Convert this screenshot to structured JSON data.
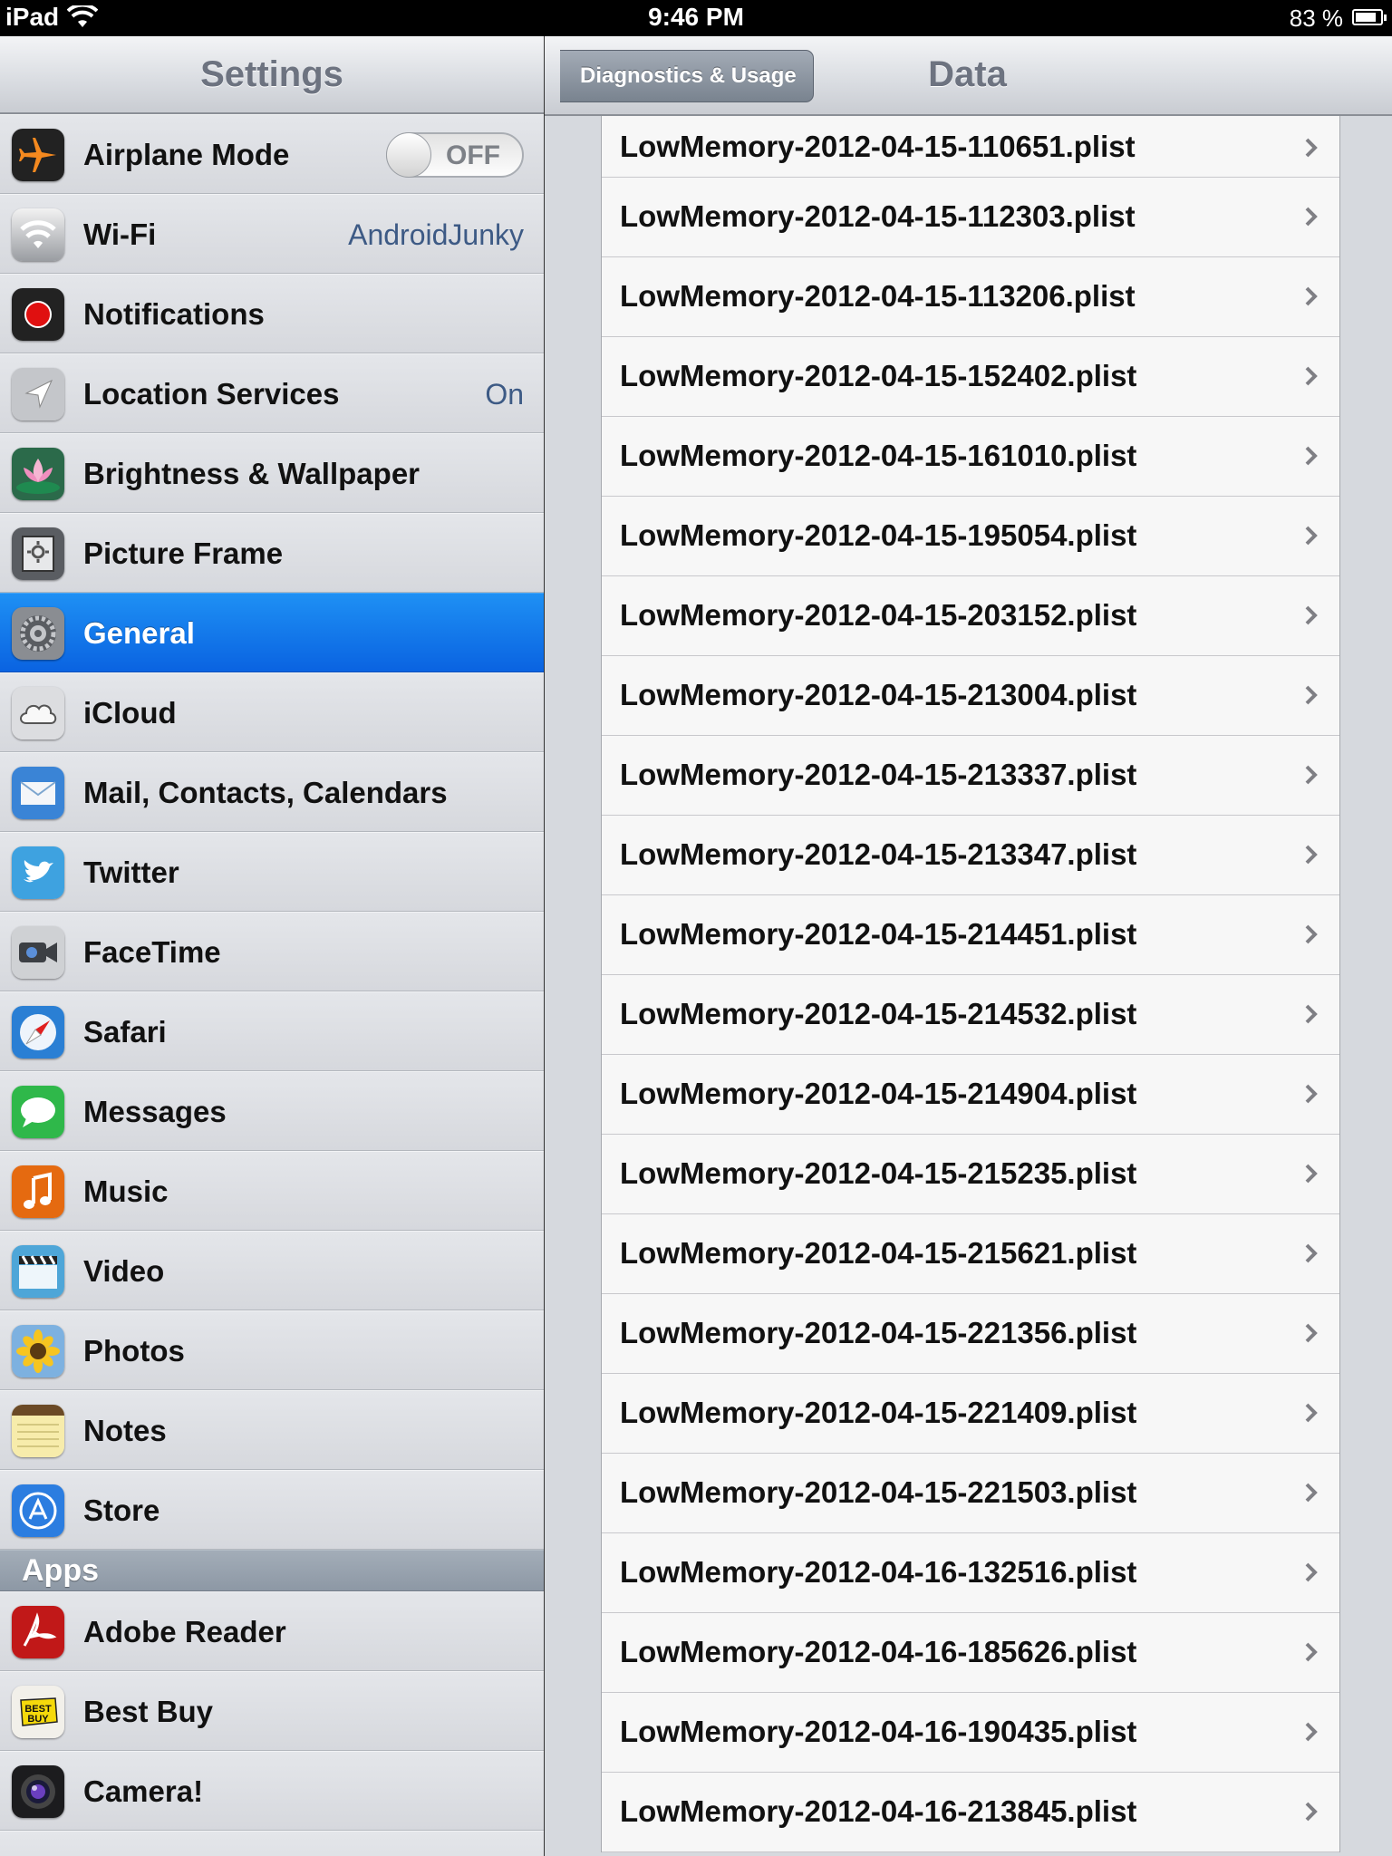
{
  "status_bar": {
    "device": "iPad",
    "time": "9:46 PM",
    "battery_percent": "83 %",
    "battery_level": 0.83
  },
  "master": {
    "title": "Settings",
    "items": [
      {
        "label": "Airplane Mode",
        "icon": "airplane-icon",
        "toggle": "OFF"
      },
      {
        "label": "Wi-Fi",
        "icon": "wifi-icon",
        "value": "AndroidJunky"
      },
      {
        "label": "Notifications",
        "icon": "notifications-icon"
      },
      {
        "label": "Location Services",
        "icon": "location-icon",
        "value": "On"
      },
      {
        "label": "Brightness & Wallpaper",
        "icon": "lotus-icon"
      },
      {
        "label": "Picture Frame",
        "icon": "picture-frame-icon"
      },
      {
        "label": "General",
        "icon": "gear-icon",
        "selected": true
      },
      {
        "label": "iCloud",
        "icon": "cloud-icon"
      },
      {
        "label": "Mail, Contacts, Calendars",
        "icon": "mail-icon"
      },
      {
        "label": "Twitter",
        "icon": "twitter-bird-icon"
      },
      {
        "label": "FaceTime",
        "icon": "facetime-camera-icon"
      },
      {
        "label": "Safari",
        "icon": "compass-icon"
      },
      {
        "label": "Messages",
        "icon": "speech-bubble-icon"
      },
      {
        "label": "Music",
        "icon": "music-note-icon"
      },
      {
        "label": "Video",
        "icon": "clapperboard-icon"
      },
      {
        "label": "Photos",
        "icon": "sunflower-icon"
      },
      {
        "label": "Notes",
        "icon": "notepad-icon"
      },
      {
        "label": "Store",
        "icon": "app-store-icon"
      }
    ],
    "apps_header": "Apps",
    "apps": [
      {
        "label": "Adobe Reader",
        "icon": "adobe-reader-icon"
      },
      {
        "label": "Best Buy",
        "icon": "best-buy-icon",
        "icon_text": "BEST BUY"
      },
      {
        "label": "Camera!",
        "icon": "camera-lens-icon"
      }
    ]
  },
  "detail": {
    "title": "Data",
    "back_label": "Diagnostics & Usage",
    "files": [
      "LowMemory-2012-04-15-110651.plist",
      "LowMemory-2012-04-15-112303.plist",
      "LowMemory-2012-04-15-113206.plist",
      "LowMemory-2012-04-15-152402.plist",
      "LowMemory-2012-04-15-161010.plist",
      "LowMemory-2012-04-15-195054.plist",
      "LowMemory-2012-04-15-203152.plist",
      "LowMemory-2012-04-15-213004.plist",
      "LowMemory-2012-04-15-213337.plist",
      "LowMemory-2012-04-15-213347.plist",
      "LowMemory-2012-04-15-214451.plist",
      "LowMemory-2012-04-15-214532.plist",
      "LowMemory-2012-04-15-214904.plist",
      "LowMemory-2012-04-15-215235.plist",
      "LowMemory-2012-04-15-215621.plist",
      "LowMemory-2012-04-15-221356.plist",
      "LowMemory-2012-04-15-221409.plist",
      "LowMemory-2012-04-15-221503.plist",
      "LowMemory-2012-04-16-132516.plist",
      "LowMemory-2012-04-16-185626.plist",
      "LowMemory-2012-04-16-190435.plist",
      "LowMemory-2012-04-16-213845.plist"
    ]
  },
  "colors": {
    "selected_row": "#0a63e1",
    "value_text": "#3d5a85",
    "apps_header": "#8d98a5"
  }
}
